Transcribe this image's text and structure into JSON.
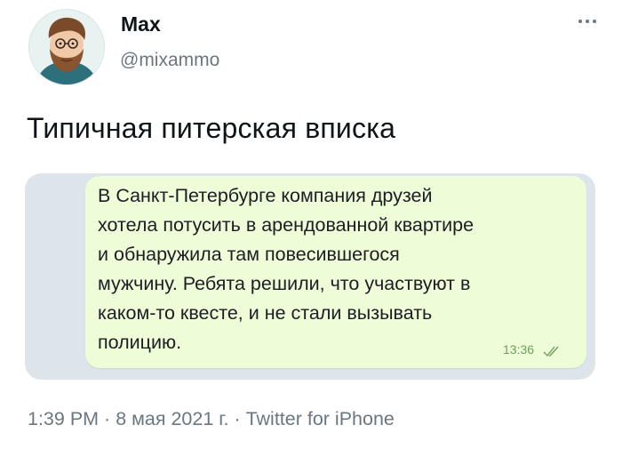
{
  "author": {
    "name": "Max",
    "handle": "@mixammo"
  },
  "tweet": {
    "text": "Типичная питерская вписка"
  },
  "message": {
    "lines": [
      "В Санкт-Петербурге компания друзей",
      "хотела потусить в арендованной квартире",
      "и обнаружила там повесившегося",
      "мужчину. Ребята решили, что участвуют в",
      "каком-то квесте, и не стали вызывать",
      "полицию."
    ],
    "time": "13:36"
  },
  "meta": {
    "time": "1:39 PM",
    "separator": " · ",
    "date": "8 мая 2021 г.",
    "source": "Twitter for iPhone"
  },
  "icons": {
    "more": "more-dots-icon",
    "read": "double-check-icon"
  },
  "colors": {
    "bubble": "#eefcd8",
    "chat_background": "#dde5ea",
    "secondary_text": "#6b7780"
  }
}
